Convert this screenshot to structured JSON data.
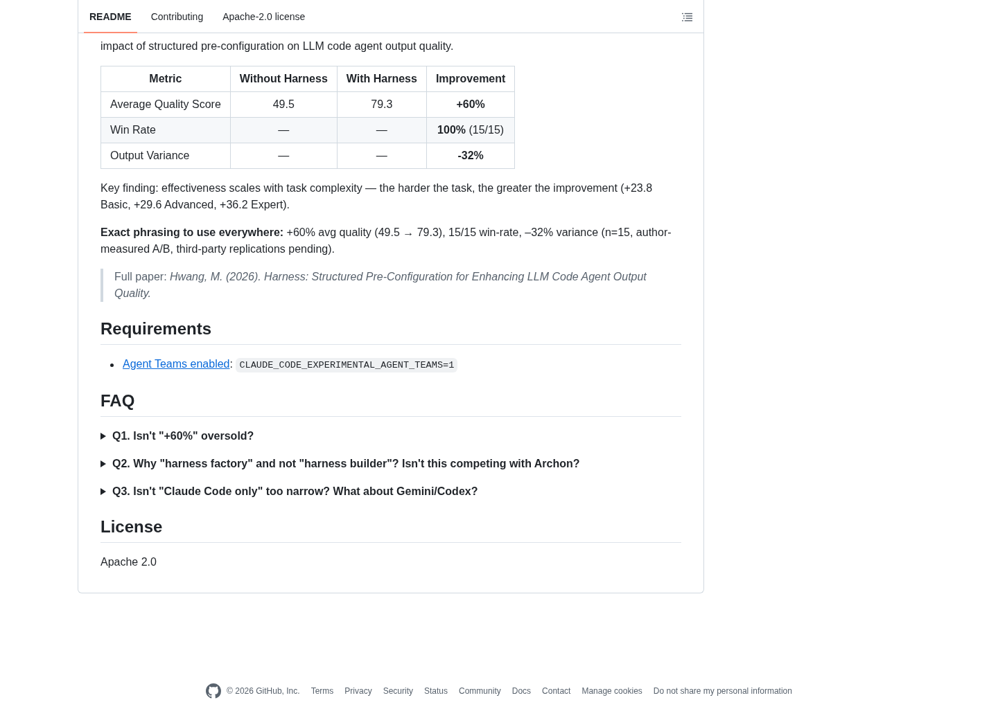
{
  "tabs": [
    {
      "label": "README",
      "selected": true
    },
    {
      "label": "Contributing",
      "selected": false
    },
    {
      "label": "Apache-2.0 license",
      "selected": false
    }
  ],
  "intro_text": "impact of structured pre-configuration on LLM code agent output quality.",
  "results_table": {
    "columns": [
      "Metric",
      "Without Harness",
      "With Harness",
      "Improvement"
    ],
    "rows": [
      {
        "metric": "Average Quality Score",
        "without_harness": "49.5",
        "with_harness": "79.3",
        "improvement": "+60%"
      },
      {
        "metric": "Win Rate",
        "without_harness": "—",
        "with_harness": "—",
        "improvement": "100%",
        "improvement_note": "(15/15)"
      },
      {
        "metric": "Output Variance",
        "without_harness": "—",
        "with_harness": "—",
        "improvement": "-32%"
      }
    ]
  },
  "key_finding": "Key finding: effectiveness scales with task complexity — the harder the task, the greater the improvement (+23.8 Basic, +29.6 Advanced, +36.2 Expert).",
  "exact_phrasing": "**Exact phrasing to use everywhere:** +60% avg quality (49.5 → 79.3), 15/15 win-rate, –32% variance (n=15, author-measured A/B, third-party replications pending).",
  "blockquote": "Full paper: *Hwang, M. (2026). Harness: Structured Pre-Configuration for Enhancing LLM Code Agent Output Quality.*",
  "requirements": {
    "heading": "Requirements",
    "items": [
      {
        "link": "Agent Teams enabled",
        "separator": ":",
        "code": "CLAUDE_CODE_EXPERIMENTAL_AGENT_TEAMS=1"
      }
    ]
  },
  "faq": {
    "heading": "FAQ",
    "items": [
      {
        "question": "Q1. Isn't \"+60%\" oversold?",
        "expanded": false
      },
      {
        "question": "Q2. Why \"harness factory\" and not \"harness builder\"? Isn't this competing with Archon?",
        "expanded": false
      },
      {
        "question": "Q3. Isn't \"Claude Code only\" too narrow? What about Gemini/Codex?",
        "expanded": false
      }
    ]
  },
  "license": {
    "heading": "License",
    "text": "Apache 2.0"
  },
  "footer": {
    "copyright": "© 2026 GitHub, Inc.",
    "links": [
      "Terms",
      "Privacy",
      "Security",
      "Status",
      "Community",
      "Docs",
      "Contact",
      "Manage cookies",
      "Do not share my personal information"
    ]
  }
}
